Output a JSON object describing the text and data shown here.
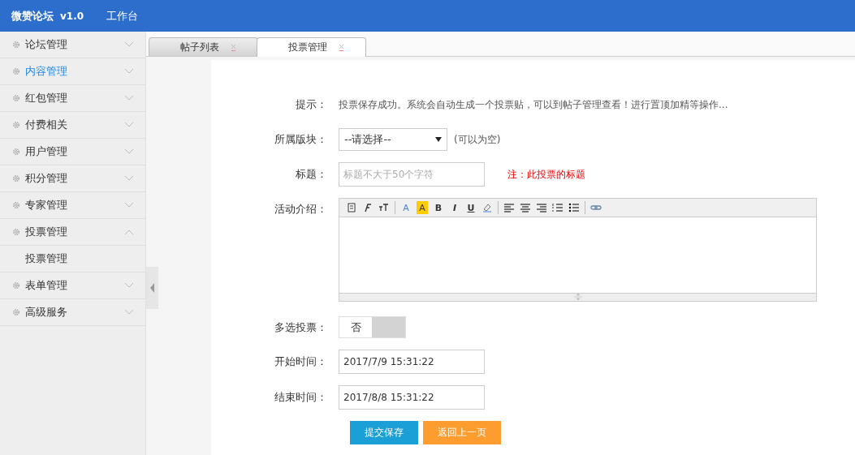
{
  "header": {
    "brand": "微赞论坛",
    "version": "v1.0",
    "nav": "工作台"
  },
  "sidebar": {
    "items": [
      {
        "label": "论坛管理",
        "selected": false,
        "expanded": false
      },
      {
        "label": "内容管理",
        "selected": true,
        "expanded": false
      },
      {
        "label": "红包管理",
        "selected": false,
        "expanded": false
      },
      {
        "label": "付费相关",
        "selected": false,
        "expanded": false
      },
      {
        "label": "用户管理",
        "selected": false,
        "expanded": false
      },
      {
        "label": "积分管理",
        "selected": false,
        "expanded": false
      },
      {
        "label": "专家管理",
        "selected": false,
        "expanded": false
      },
      {
        "label": "投票管理",
        "selected": false,
        "expanded": true,
        "children": [
          {
            "label": "投票管理"
          }
        ]
      },
      {
        "label": "表单管理",
        "selected": false,
        "expanded": false
      },
      {
        "label": "高级服务",
        "selected": false,
        "expanded": false
      }
    ]
  },
  "tabs": [
    {
      "label": "帖子列表",
      "selected": false
    },
    {
      "label": "投票管理",
      "selected": true
    }
  ],
  "form": {
    "notice": {
      "label": "提示：",
      "text": "投票保存成功。系统会自动生成一个投票贴，可以到帖子管理查看！进行置顶加精等操作..."
    },
    "board": {
      "label": "所属版块：",
      "value": "--请选择--",
      "hint": "(可以为空)"
    },
    "title": {
      "label": "标题：",
      "placeholder": "标题不大于50个字符",
      "note": "注：此投票的标题"
    },
    "intro": {
      "label": "活动介绍：",
      "toolbar": [
        {
          "kind": "paste"
        },
        {
          "kind": "font"
        },
        {
          "kind": "size"
        },
        {
          "kind": "sep"
        },
        {
          "kind": "color",
          "label": "A"
        },
        {
          "kind": "highlight",
          "label": "A"
        },
        {
          "kind": "bold",
          "label": "B"
        },
        {
          "kind": "italic",
          "label": "I"
        },
        {
          "kind": "underline",
          "label": "U"
        },
        {
          "kind": "eraser"
        },
        {
          "kind": "sep"
        },
        {
          "kind": "align-left"
        },
        {
          "kind": "align-center"
        },
        {
          "kind": "align-right"
        },
        {
          "kind": "ordered-list"
        },
        {
          "kind": "bullet-list"
        },
        {
          "kind": "sep"
        },
        {
          "kind": "link"
        }
      ]
    },
    "multi": {
      "label": "多选投票：",
      "on": false,
      "text": "否"
    },
    "start": {
      "label": "开始时间：",
      "value": "2017/7/9 15:31:22"
    },
    "end": {
      "label": "结束时间：",
      "value": "2017/8/8 15:31:22"
    },
    "buttons": [
      {
        "label": "提交保存",
        "kind": "primary"
      },
      {
        "label": "返回上一页",
        "kind": "secondary"
      }
    ]
  }
}
